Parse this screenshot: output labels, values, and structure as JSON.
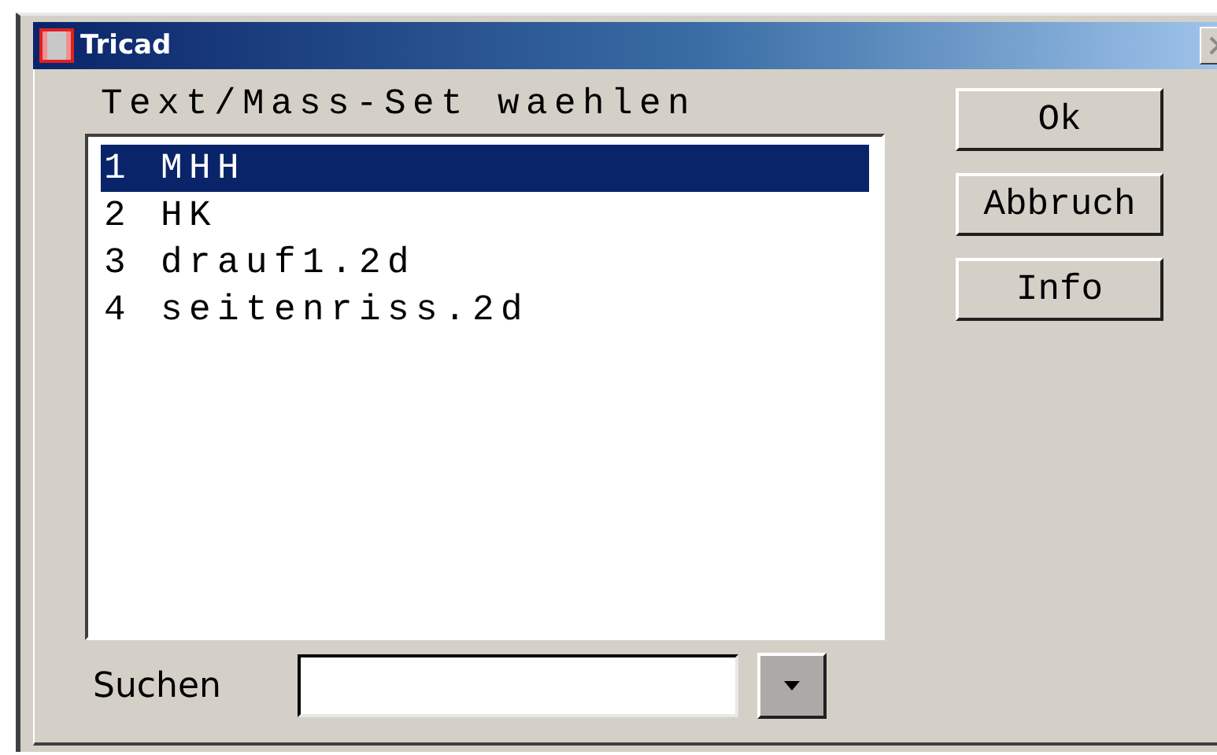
{
  "window": {
    "title": "Tricad"
  },
  "prompt": "Text/Mass-Set waehlen",
  "items": [
    {
      "label": "1 MHH",
      "selected": true
    },
    {
      "label": "2 HK",
      "selected": false
    },
    {
      "label": "3 drauf1.2d",
      "selected": false
    },
    {
      "label": "4 seitenriss.2d",
      "selected": false
    }
  ],
  "buttons": [
    "Ok",
    "Abbruch",
    "Info"
  ],
  "search": {
    "label": "Suchen"
  }
}
